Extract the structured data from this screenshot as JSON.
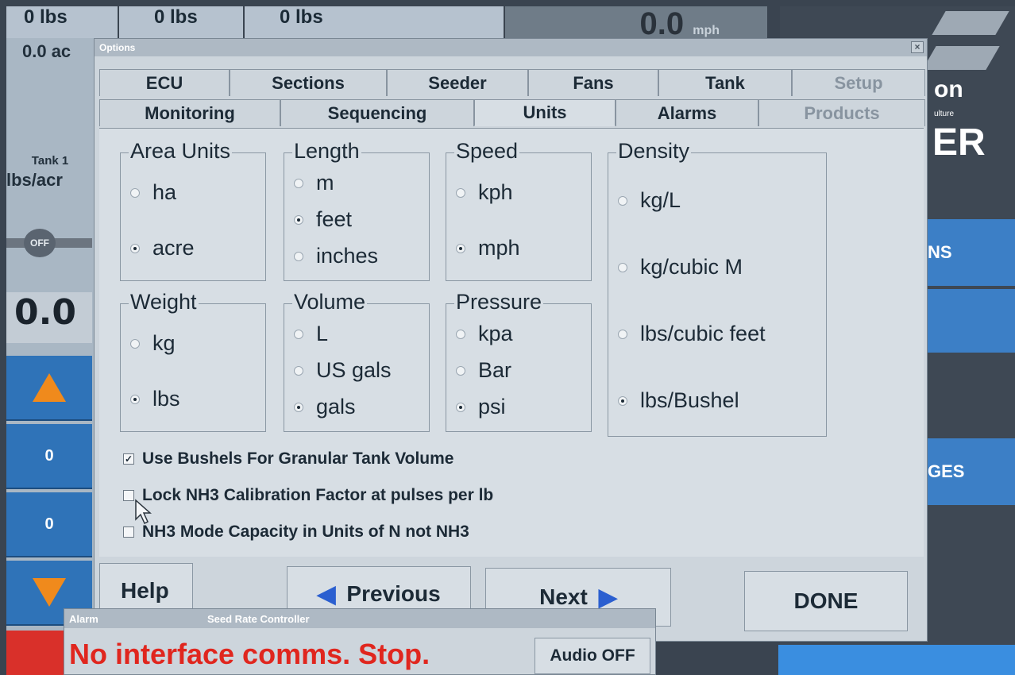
{
  "background": {
    "top_cells": [
      "0 lbs",
      "0 lbs",
      "0 lbs"
    ],
    "left_area": "0.0 ac",
    "speed_value": "0.0",
    "speed_unit": "mph",
    "tank_label": "Tank 1",
    "tank_unit": "lbs/acr",
    "toggle_label": "OFF",
    "rate_value": "0.0",
    "counter_1": "0",
    "counter_2": "0",
    "right_brand_1": "on",
    "right_brand_2": "ulture",
    "right_brand_3": "ER",
    "right_btn_1": "NS",
    "right_btn_2": "GES",
    "colors": {
      "accent_blue": "#2f73b8",
      "alarm_red": "#e0261e",
      "arrow_orange": "#f08a1c"
    }
  },
  "dialog": {
    "title": "Options",
    "tabs_row1": [
      {
        "label": "ECU",
        "enabled": true
      },
      {
        "label": "Sections",
        "enabled": true
      },
      {
        "label": "Seeder",
        "enabled": true
      },
      {
        "label": "Fans",
        "enabled": true
      },
      {
        "label": "Tank",
        "enabled": true
      },
      {
        "label": "Setup",
        "enabled": false
      }
    ],
    "tabs_row2": [
      {
        "label": "Monitoring",
        "enabled": true
      },
      {
        "label": "Sequencing",
        "enabled": true
      },
      {
        "label": "Units",
        "enabled": true,
        "active": true
      },
      {
        "label": "Alarms",
        "enabled": true
      },
      {
        "label": "Products",
        "enabled": false
      }
    ],
    "groups": {
      "area": {
        "title": "Area Units",
        "options": [
          "ha",
          "acre"
        ],
        "selected": "acre"
      },
      "length": {
        "title": "Length",
        "options": [
          "m",
          "feet",
          "inches"
        ],
        "selected": "feet"
      },
      "speed": {
        "title": "Speed",
        "options": [
          "kph",
          "mph"
        ],
        "selected": "mph"
      },
      "density": {
        "title": "Density",
        "options": [
          "kg/L",
          "kg/cubic M",
          "lbs/cubic feet",
          "lbs/Bushel"
        ],
        "selected": "lbs/Bushel"
      },
      "weight": {
        "title": "Weight",
        "options": [
          "kg",
          "lbs"
        ],
        "selected": "lbs"
      },
      "volume": {
        "title": "Volume",
        "options": [
          "L",
          "US gals",
          "gals"
        ],
        "selected": "gals"
      },
      "pressure": {
        "title": "Pressure",
        "options": [
          "kpa",
          "Bar",
          "psi"
        ],
        "selected": "psi"
      }
    },
    "checkboxes": [
      {
        "label": "Use Bushels For Granular Tank Volume",
        "checked": true
      },
      {
        "label": "Lock NH3 Calibration Factor at pulses per lb",
        "checked": false
      },
      {
        "label": "NH3 Mode Capacity in Units of N not NH3",
        "checked": false
      }
    ],
    "buttons": {
      "help": "Help",
      "previous": "Previous",
      "next": "Next",
      "done": "DONE"
    }
  },
  "alarm": {
    "title": "Alarm",
    "source": "Seed Rate Controller",
    "message": "No interface comms. Stop.",
    "audio_button": "Audio OFF"
  }
}
